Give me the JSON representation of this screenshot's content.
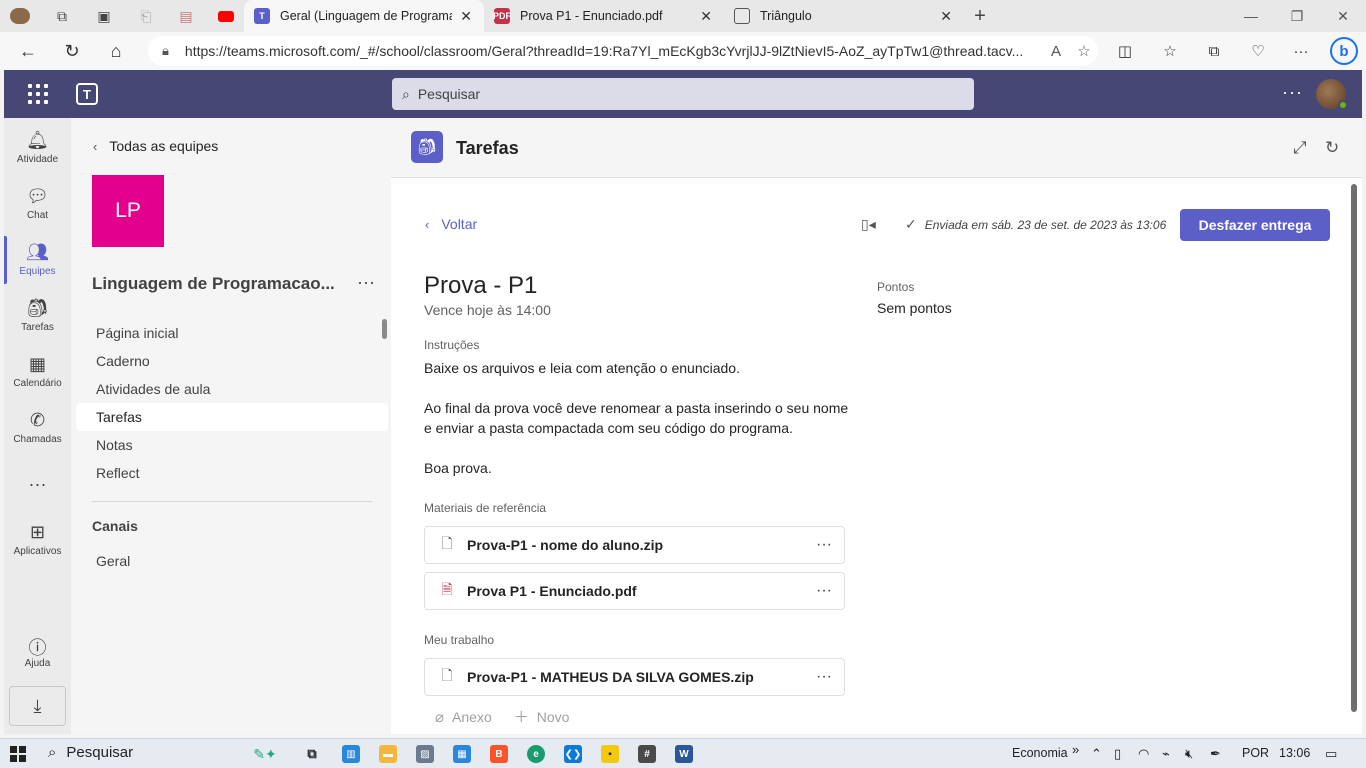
{
  "browser": {
    "tabs": [
      {
        "title": "Geral (Linguagem de Programacao",
        "active": true
      },
      {
        "title": "Prova P1 - Enunciado.pdf",
        "active": false
      },
      {
        "title": "Triângulo",
        "active": false
      }
    ],
    "url": "https://teams.microsoft.com/_#/school/classroom/Geral?threadId=19:Ra7Yl_mEcKgb3cYvrjlJJ-9lZtNievI5-AoZ_ayTpTw1@thread.tacv..."
  },
  "header": {
    "search_placeholder": "Pesquisar",
    "more": "···"
  },
  "rail": {
    "items": [
      {
        "label": "Atividade",
        "icon": "bell-icon"
      },
      {
        "label": "Chat",
        "icon": "chat-icon"
      },
      {
        "label": "Equipes",
        "icon": "teams-icon",
        "active": true
      },
      {
        "label": "Tarefas",
        "icon": "backpack-icon"
      },
      {
        "label": "Calendário",
        "icon": "calendar-icon"
      },
      {
        "label": "Chamadas",
        "icon": "phone-icon"
      },
      {
        "label": "Aplicativos",
        "icon": "apps-icon"
      },
      {
        "label": "Ajuda",
        "icon": "help-icon"
      }
    ],
    "more": "···"
  },
  "team_panel": {
    "back_label": "Todas as equipes",
    "team_initials": "LP",
    "team_name": "Linguagem de Programacao...",
    "nav": [
      "Página inicial",
      "Caderno",
      "Atividades de aula",
      "Tarefas",
      "Notas",
      "Reflect"
    ],
    "active_nav": "Tarefas",
    "channels_heading": "Canais",
    "channels": [
      "Geral"
    ]
  },
  "main": {
    "app_title": "Tarefas",
    "back_label": "Voltar",
    "sent_status": "Enviada em sáb. 23 de set. de 2023 às 13:06",
    "undo_button": "Desfazer entrega",
    "assignment_title": "Prova - P1",
    "due": "Vence hoje às 14:00",
    "instructions_label": "Instruções",
    "instructions": [
      "Baixe os arquivos e leia com atenção o enunciado.",
      "Ao final da prova você deve renomear a pasta inserindo o seu nome e enviar a pasta compactada com seu código do programa.",
      "Boa prova."
    ],
    "points_label": "Pontos",
    "points_value": "Sem pontos",
    "reference_label": "Materiais de referência",
    "reference_files": [
      {
        "name": "Prova-P1 - nome do aluno.zip",
        "icon": "file-icon"
      },
      {
        "name": "Prova P1 - Enunciado.pdf",
        "icon": "pdf-icon"
      }
    ],
    "my_work_label": "Meu trabalho",
    "my_work_files": [
      {
        "name": "Prova-P1 - MATHEUS DA SILVA GOMES.zip",
        "icon": "file-icon"
      }
    ],
    "attach_label": "Anexo",
    "new_label": "Novo"
  },
  "taskbar": {
    "search_label": "Pesquisar",
    "weather": "Economia",
    "language": "POR",
    "time": "13:06"
  },
  "colors": {
    "teams_header": "#464775",
    "accent": "#5b5fc7",
    "team_tile": "#e3008c"
  }
}
